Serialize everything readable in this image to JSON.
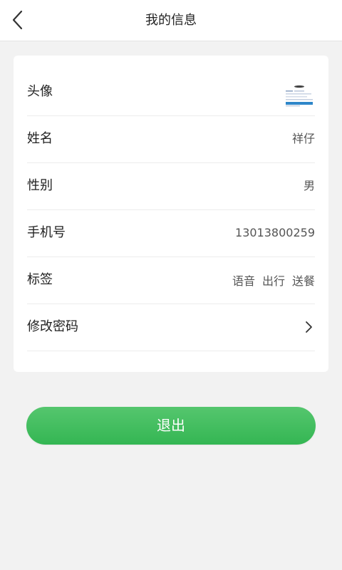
{
  "header": {
    "title": "我的信息",
    "back_icon": "chevron-left-icon"
  },
  "profile": {
    "avatar_label": "头像",
    "name_label": "姓名",
    "name_value": "祥仔",
    "gender_label": "性别",
    "gender_value": "男",
    "phone_label": "手机号",
    "phone_value": "13013800259",
    "tags_label": "标签",
    "tags": [
      "语音",
      "出行",
      "送餐"
    ],
    "password_label": "修改密码",
    "password_icon": "chevron-right-icon"
  },
  "actions": {
    "logout_label": "退出",
    "logout_color": "#3bb859"
  }
}
